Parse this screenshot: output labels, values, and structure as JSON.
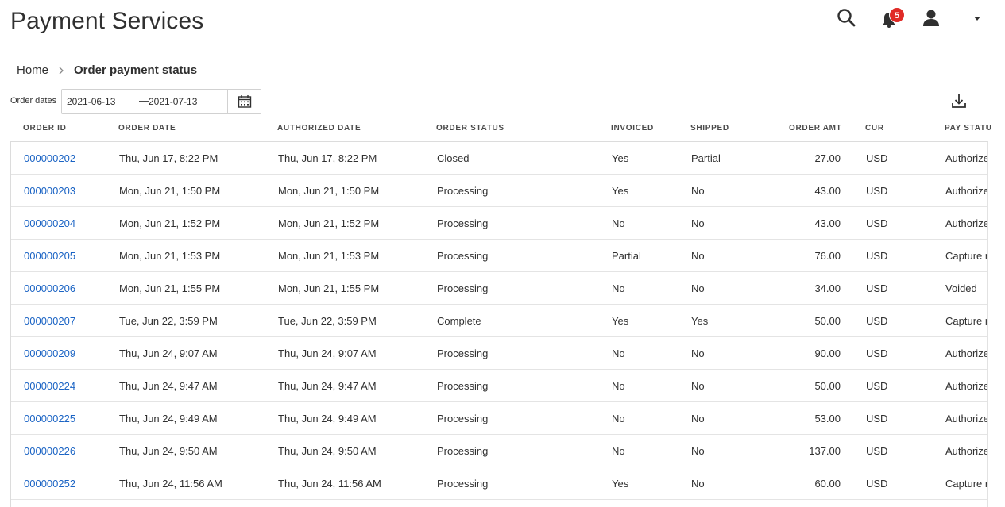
{
  "app": {
    "title": "Payment Services"
  },
  "header": {
    "notification_count": "5"
  },
  "breadcrumb": {
    "home": "Home",
    "current": "Order payment status"
  },
  "filter": {
    "label": "Order dates",
    "date_from": "2021-06-13",
    "separator": "—",
    "date_to": "2021-07-13"
  },
  "table": {
    "columns": [
      "ORDER ID",
      "ORDER DATE",
      "AUTHORIZED DATE",
      "ORDER STATUS",
      "INVOICED",
      "SHIPPED",
      "ORDER AMT",
      "CUR",
      "PAY STATU"
    ],
    "rows": [
      {
        "order_id": "000000202",
        "order_date": "Thu, Jun 17, 8:22 PM",
        "authorized_date": "Thu, Jun 17, 8:22 PM",
        "order_status": "Closed",
        "invoiced": "Yes",
        "shipped": "Partial",
        "order_amt": "27.00",
        "cur": "USD",
        "pay_status": "Authorize"
      },
      {
        "order_id": "000000203",
        "order_date": "Mon, Jun 21, 1:50 PM",
        "authorized_date": "Mon, Jun 21, 1:50 PM",
        "order_status": "Processing",
        "invoiced": "Yes",
        "shipped": "No",
        "order_amt": "43.00",
        "cur": "USD",
        "pay_status": "Authorize"
      },
      {
        "order_id": "000000204",
        "order_date": "Mon, Jun 21, 1:52 PM",
        "authorized_date": "Mon, Jun 21, 1:52 PM",
        "order_status": "Processing",
        "invoiced": "No",
        "shipped": "No",
        "order_amt": "43.00",
        "cur": "USD",
        "pay_status": "Authorize"
      },
      {
        "order_id": "000000205",
        "order_date": "Mon, Jun 21, 1:53 PM",
        "authorized_date": "Mon, Jun 21, 1:53 PM",
        "order_status": "Processing",
        "invoiced": "Partial",
        "shipped": "No",
        "order_amt": "76.00",
        "cur": "USD",
        "pay_status": "Capture r"
      },
      {
        "order_id": "000000206",
        "order_date": "Mon, Jun 21, 1:55 PM",
        "authorized_date": "Mon, Jun 21, 1:55 PM",
        "order_status": "Processing",
        "invoiced": "No",
        "shipped": "No",
        "order_amt": "34.00",
        "cur": "USD",
        "pay_status": "Voided"
      },
      {
        "order_id": "000000207",
        "order_date": "Tue, Jun 22, 3:59 PM",
        "authorized_date": "Tue, Jun 22, 3:59 PM",
        "order_status": "Complete",
        "invoiced": "Yes",
        "shipped": "Yes",
        "order_amt": "50.00",
        "cur": "USD",
        "pay_status": "Capture r"
      },
      {
        "order_id": "000000209",
        "order_date": "Thu, Jun 24, 9:07 AM",
        "authorized_date": "Thu, Jun 24, 9:07 AM",
        "order_status": "Processing",
        "invoiced": "No",
        "shipped": "No",
        "order_amt": "90.00",
        "cur": "USD",
        "pay_status": "Authorize"
      },
      {
        "order_id": "000000224",
        "order_date": "Thu, Jun 24, 9:47 AM",
        "authorized_date": "Thu, Jun 24, 9:47 AM",
        "order_status": "Processing",
        "invoiced": "No",
        "shipped": "No",
        "order_amt": "50.00",
        "cur": "USD",
        "pay_status": "Authorize"
      },
      {
        "order_id": "000000225",
        "order_date": "Thu, Jun 24, 9:49 AM",
        "authorized_date": "Thu, Jun 24, 9:49 AM",
        "order_status": "Processing",
        "invoiced": "No",
        "shipped": "No",
        "order_amt": "53.00",
        "cur": "USD",
        "pay_status": "Authorize"
      },
      {
        "order_id": "000000226",
        "order_date": "Thu, Jun 24, 9:50 AM",
        "authorized_date": "Thu, Jun 24, 9:50 AM",
        "order_status": "Processing",
        "invoiced": "No",
        "shipped": "No",
        "order_amt": "137.00",
        "cur": "USD",
        "pay_status": "Authorize"
      },
      {
        "order_id": "000000252",
        "order_date": "Thu, Jun 24, 11:56 AM",
        "authorized_date": "Thu, Jun 24, 11:56 AM",
        "order_status": "Processing",
        "invoiced": "Yes",
        "shipped": "No",
        "order_amt": "60.00",
        "cur": "USD",
        "pay_status": "Capture r"
      }
    ]
  },
  "colors": {
    "link": "#1a63c4",
    "badge": "#e02b27",
    "border": "#dcdcdc",
    "text": "#303030"
  },
  "icons": [
    "search-icon",
    "bell-icon",
    "user-icon",
    "chevron-down-icon",
    "chevron-right-icon",
    "calendar-icon",
    "download-icon"
  ]
}
